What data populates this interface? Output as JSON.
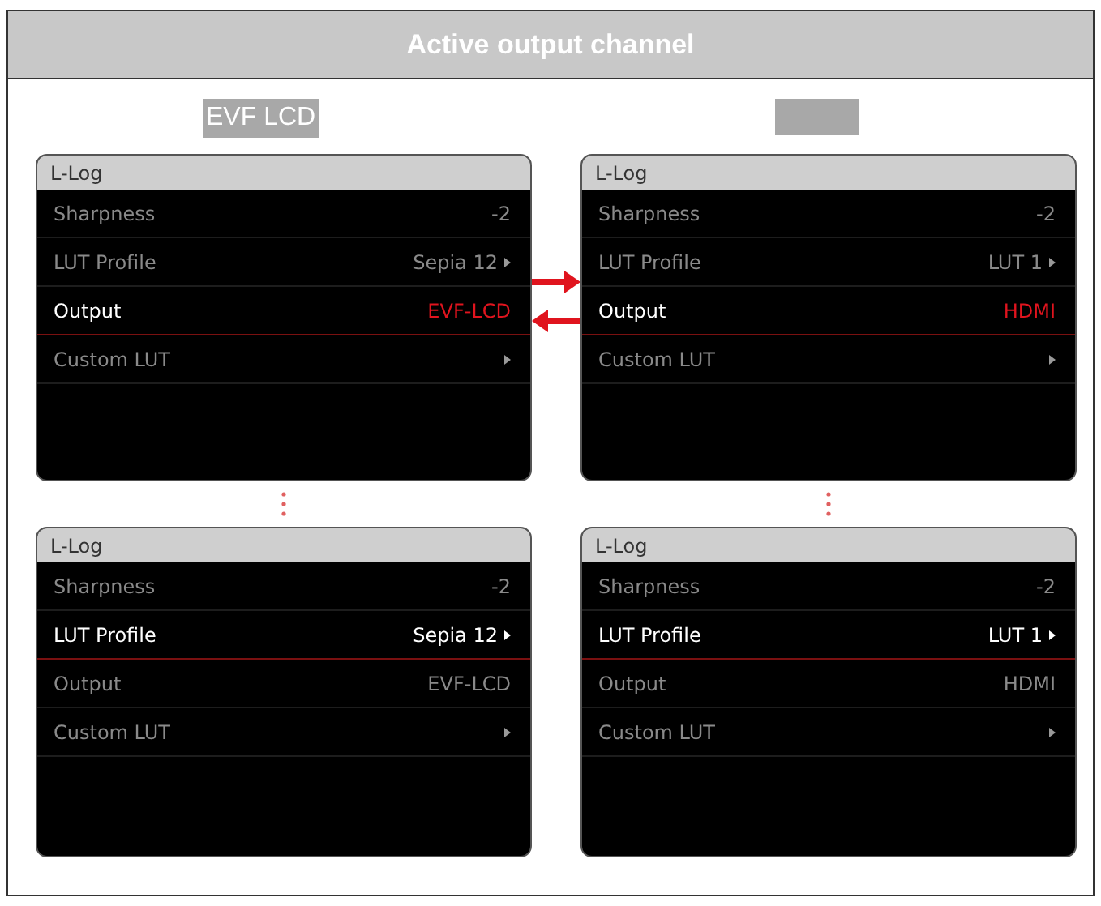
{
  "title": "Active output channel",
  "channel_labels": [
    {
      "kind": "text",
      "text": "EVF LCD"
    },
    {
      "kind": "blank"
    }
  ],
  "screens": [
    {
      "title": "L-Log",
      "rows": [
        {
          "label": "Sharpness",
          "value": "-2",
          "submenu": false,
          "selected": false,
          "value_highlight": false
        },
        {
          "label": "LUT Profile",
          "value": "Sepia 12",
          "submenu": true,
          "selected": false,
          "value_highlight": false
        },
        {
          "label": "Output",
          "value": "EVF-LCD",
          "submenu": false,
          "selected": true,
          "value_highlight": true
        },
        {
          "label": "Custom LUT",
          "submenu": true,
          "selected": false
        }
      ]
    },
    {
      "title": "L-Log",
      "rows": [
        {
          "label": "Sharpness",
          "value": "-2",
          "submenu": false,
          "selected": false,
          "value_highlight": false
        },
        {
          "label": "LUT Profile",
          "value": "LUT 1",
          "submenu": true,
          "selected": false,
          "value_highlight": false
        },
        {
          "label": "Output",
          "value": "HDMI",
          "submenu": false,
          "selected": true,
          "value_highlight": true
        },
        {
          "label": "Custom LUT",
          "submenu": true,
          "selected": false
        }
      ]
    },
    {
      "title": "L-Log",
      "rows": [
        {
          "label": "Sharpness",
          "value": "-2",
          "submenu": false,
          "selected": false,
          "value_highlight": false
        },
        {
          "label": "LUT Profile",
          "value": "Sepia 12",
          "submenu": true,
          "selected": true,
          "value_highlight": false
        },
        {
          "label": "Output",
          "value": "EVF-LCD",
          "submenu": false,
          "selected": false,
          "value_highlight": false
        },
        {
          "label": "Custom LUT",
          "submenu": true,
          "selected": false
        }
      ]
    },
    {
      "title": "L-Log",
      "rows": [
        {
          "label": "Sharpness",
          "value": "-2",
          "submenu": false,
          "selected": false,
          "value_highlight": false
        },
        {
          "label": "LUT Profile",
          "value": "LUT 1",
          "submenu": true,
          "selected": true,
          "value_highlight": false
        },
        {
          "label": "Output",
          "value": "HDMI",
          "submenu": false,
          "selected": false,
          "value_highlight": false
        },
        {
          "label": "Custom LUT",
          "submenu": true,
          "selected": false
        }
      ]
    }
  ]
}
